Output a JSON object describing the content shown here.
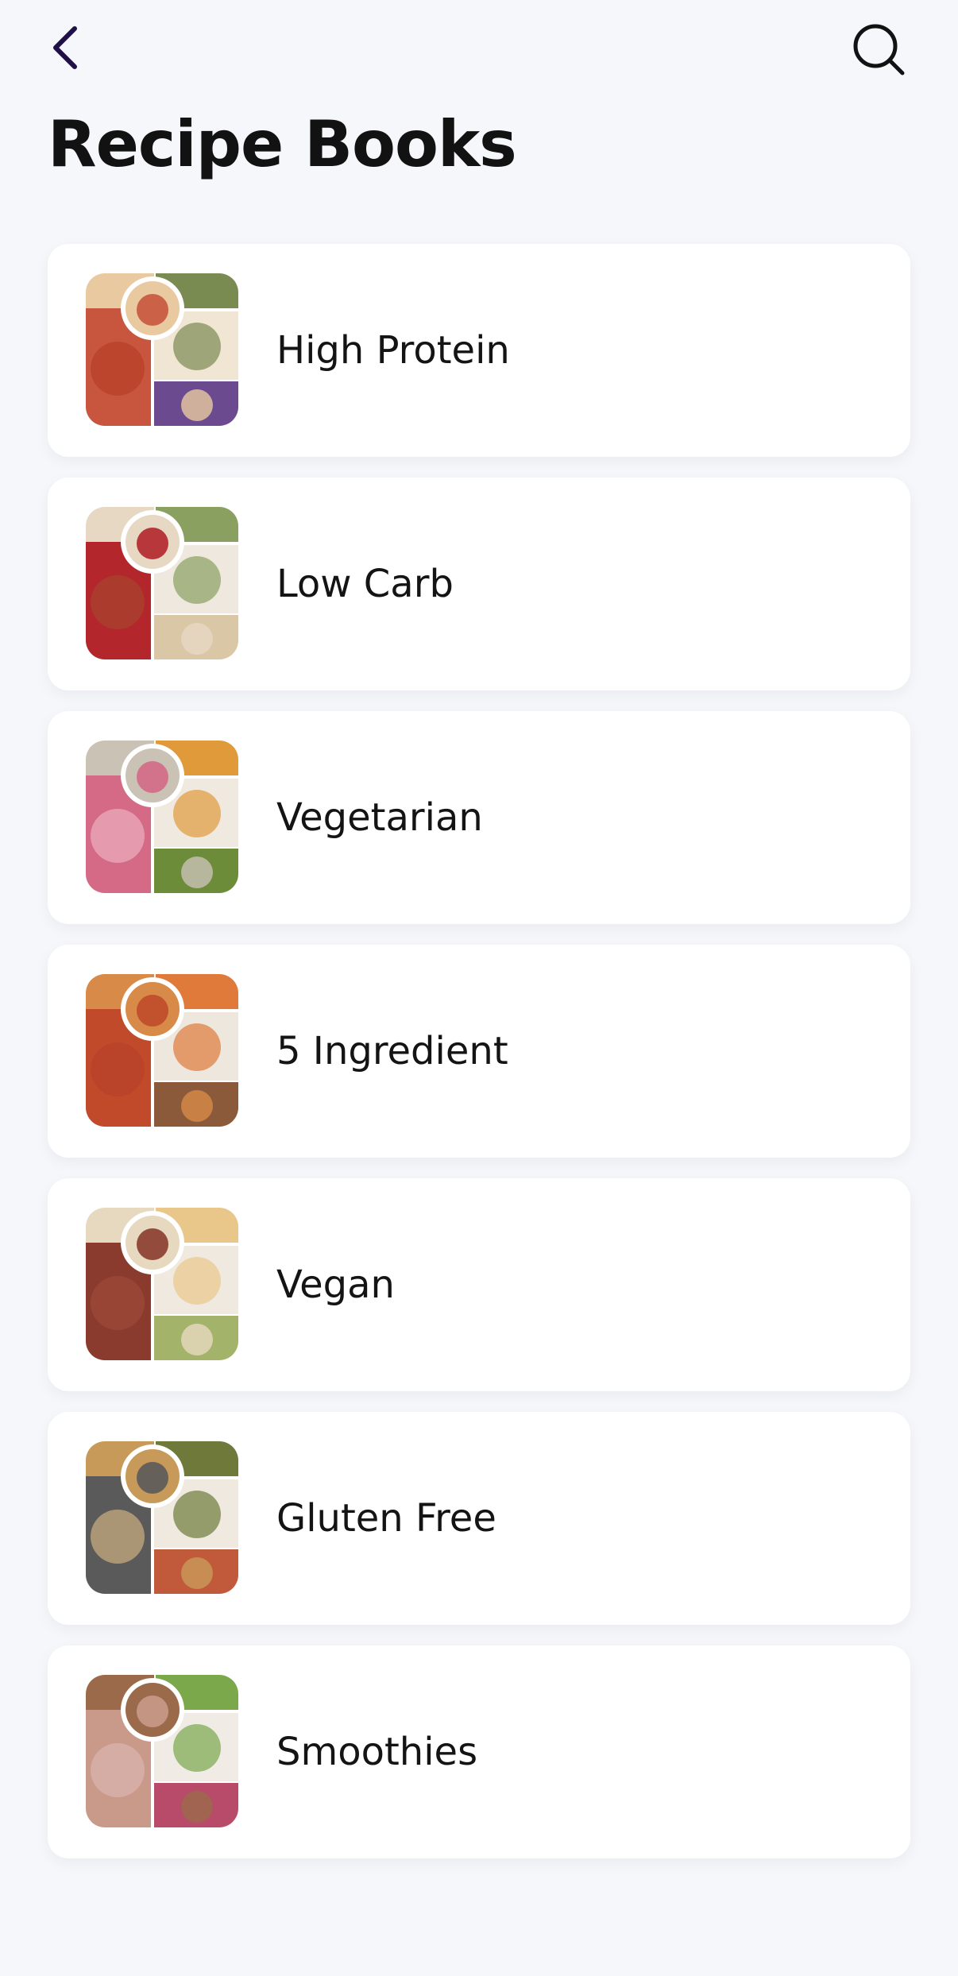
{
  "header": {
    "back_icon": "chevron-left-icon",
    "search_icon": "search-icon",
    "title": "Recipe Books",
    "accent_color": "#1f1147"
  },
  "books": [
    {
      "label": "High Protein",
      "colors": [
        "#c8553d",
        "#e8c9a0",
        "#7a8b52",
        "#f1e5d4",
        "#b8432a",
        "#6b4a8f"
      ]
    },
    {
      "label": "Low Carb",
      "colors": [
        "#b3262c",
        "#e7d8c4",
        "#8aa060",
        "#efe8df",
        "#a8402e",
        "#d9c7a6"
      ]
    },
    {
      "label": "Vegetarian",
      "colors": [
        "#d46a86",
        "#c9c2b5",
        "#e09a3a",
        "#efe9e0",
        "#e8a2b4",
        "#6c8c3a"
      ]
    },
    {
      "label": "5 Ingredient",
      "colors": [
        "#c04a2a",
        "#d88a48",
        "#e07a3a",
        "#eee7de",
        "#b8432a",
        "#8a5a3a"
      ]
    },
    {
      "label": "Vegan",
      "colors": [
        "#8a3b2e",
        "#e7d9c0",
        "#e9c68a",
        "#efe9e0",
        "#9b4836",
        "#a3b46a"
      ]
    },
    {
      "label": "Gluten Free",
      "colors": [
        "#5a5a5a",
        "#c89a5a",
        "#6f7a3a",
        "#efe9e0",
        "#b9a07a",
        "#c05a3a"
      ]
    },
    {
      "label": "Smoothies",
      "colors": [
        "#c99a8a",
        "#9a6a4a",
        "#7aa84a",
        "#f1ebe6",
        "#d8b0a8",
        "#b84a6a"
      ]
    }
  ]
}
